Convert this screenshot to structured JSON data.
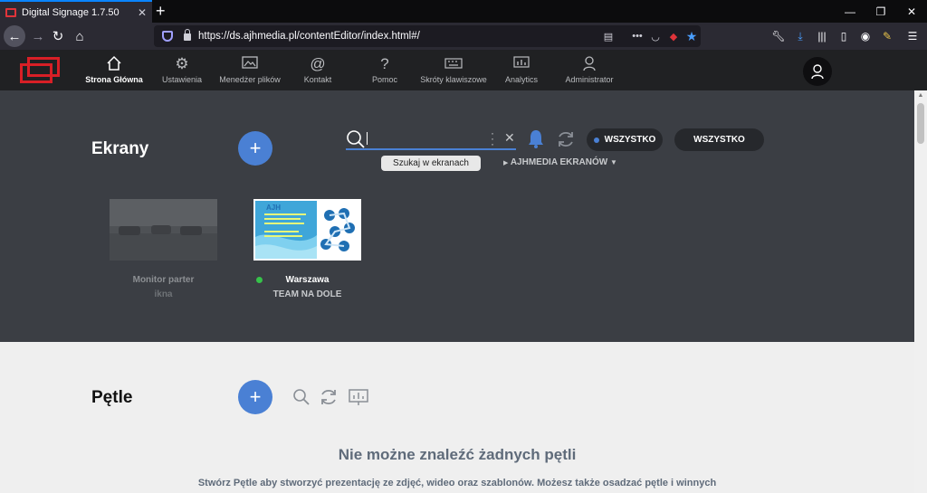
{
  "browser": {
    "tab_title": "Digital Signage 1.7.50",
    "url": "https://ds.ajhmedia.pl/contentEditor/index.html#/"
  },
  "nav": {
    "items": [
      {
        "label": "Strona Główna",
        "icon": "home-icon"
      },
      {
        "label": "Ustawienia",
        "icon": "gear-icon"
      },
      {
        "label": "Menedżer plików",
        "icon": "image-icon"
      },
      {
        "label": "Kontakt",
        "icon": "at-icon"
      },
      {
        "label": "Pomoc",
        "icon": "question-icon"
      },
      {
        "label": "Skróty klawiszowe",
        "icon": "keyboard-icon"
      },
      {
        "label": "Analytics",
        "icon": "analytics-icon"
      },
      {
        "label": "Administrator",
        "icon": "user-icon"
      }
    ],
    "active": "Strona Główna"
  },
  "screens": {
    "title": "Ekrany",
    "search_tooltip": "Szukaj w ekranach",
    "filter1": "WSZYSTKO",
    "filter2": "WSZYSTKO",
    "group_label": "AJHMEDIA EKRANÓW",
    "items": [
      {
        "name": "Monitor parter",
        "subtitle": "ikna",
        "online": false
      },
      {
        "name": "Warszawa",
        "subtitle": "TEAM NA DOLE",
        "online": true
      }
    ],
    "thumb_brand": "AJH"
  },
  "loops": {
    "title": "Pętle",
    "empty_title": "Nie możne znaleźć żadnych pętli",
    "empty_desc": "Stwórz Pętle aby stworzyć prezentację ze zdjęć, wideo oraz szablonów. Możesz także osadzać pętle i winnych"
  },
  "colors": {
    "accent": "#4a80d4",
    "brand_red": "#d81f26",
    "online": "#36c24a"
  }
}
